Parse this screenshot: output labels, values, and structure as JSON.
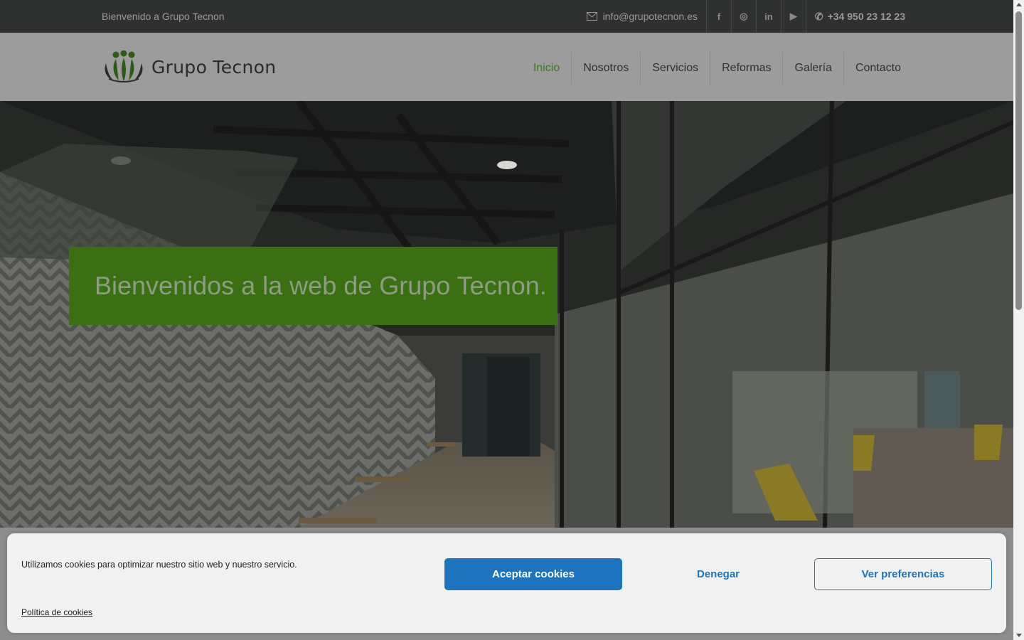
{
  "topbar": {
    "welcome": "Bienvenido a Grupo Tecnon",
    "email": "info@grupotecnon.es",
    "phone": "+34 950 23 12 23",
    "social": [
      {
        "icon": "facebook-icon",
        "glyph": "f"
      },
      {
        "icon": "instagram-icon",
        "glyph": "◎"
      },
      {
        "icon": "linkedin-icon",
        "glyph": "in"
      },
      {
        "icon": "youtube-icon",
        "glyph": "▶"
      }
    ]
  },
  "header": {
    "logo_text": "Grupo Tecnon",
    "nav": [
      {
        "label": "Inicio",
        "active": true
      },
      {
        "label": "Nosotros"
      },
      {
        "label": "Servicios"
      },
      {
        "label": "Reformas"
      },
      {
        "label": "Galería"
      },
      {
        "label": "Contacto"
      }
    ]
  },
  "hero": {
    "title": "Bienvenidos a la web de Grupo Tecnon."
  },
  "cookie": {
    "message": "Utilizamos cookies para optimizar nuestro sitio web y nuestro servicio.",
    "accept": "Aceptar cookies",
    "deny": "Denegar",
    "preferences": "Ver preferencias",
    "policy": "Política de cookies"
  },
  "colors": {
    "brand_green": "#3a6f12",
    "active_nav": "#3c7a1a",
    "accent_blue": "#1e73be"
  }
}
